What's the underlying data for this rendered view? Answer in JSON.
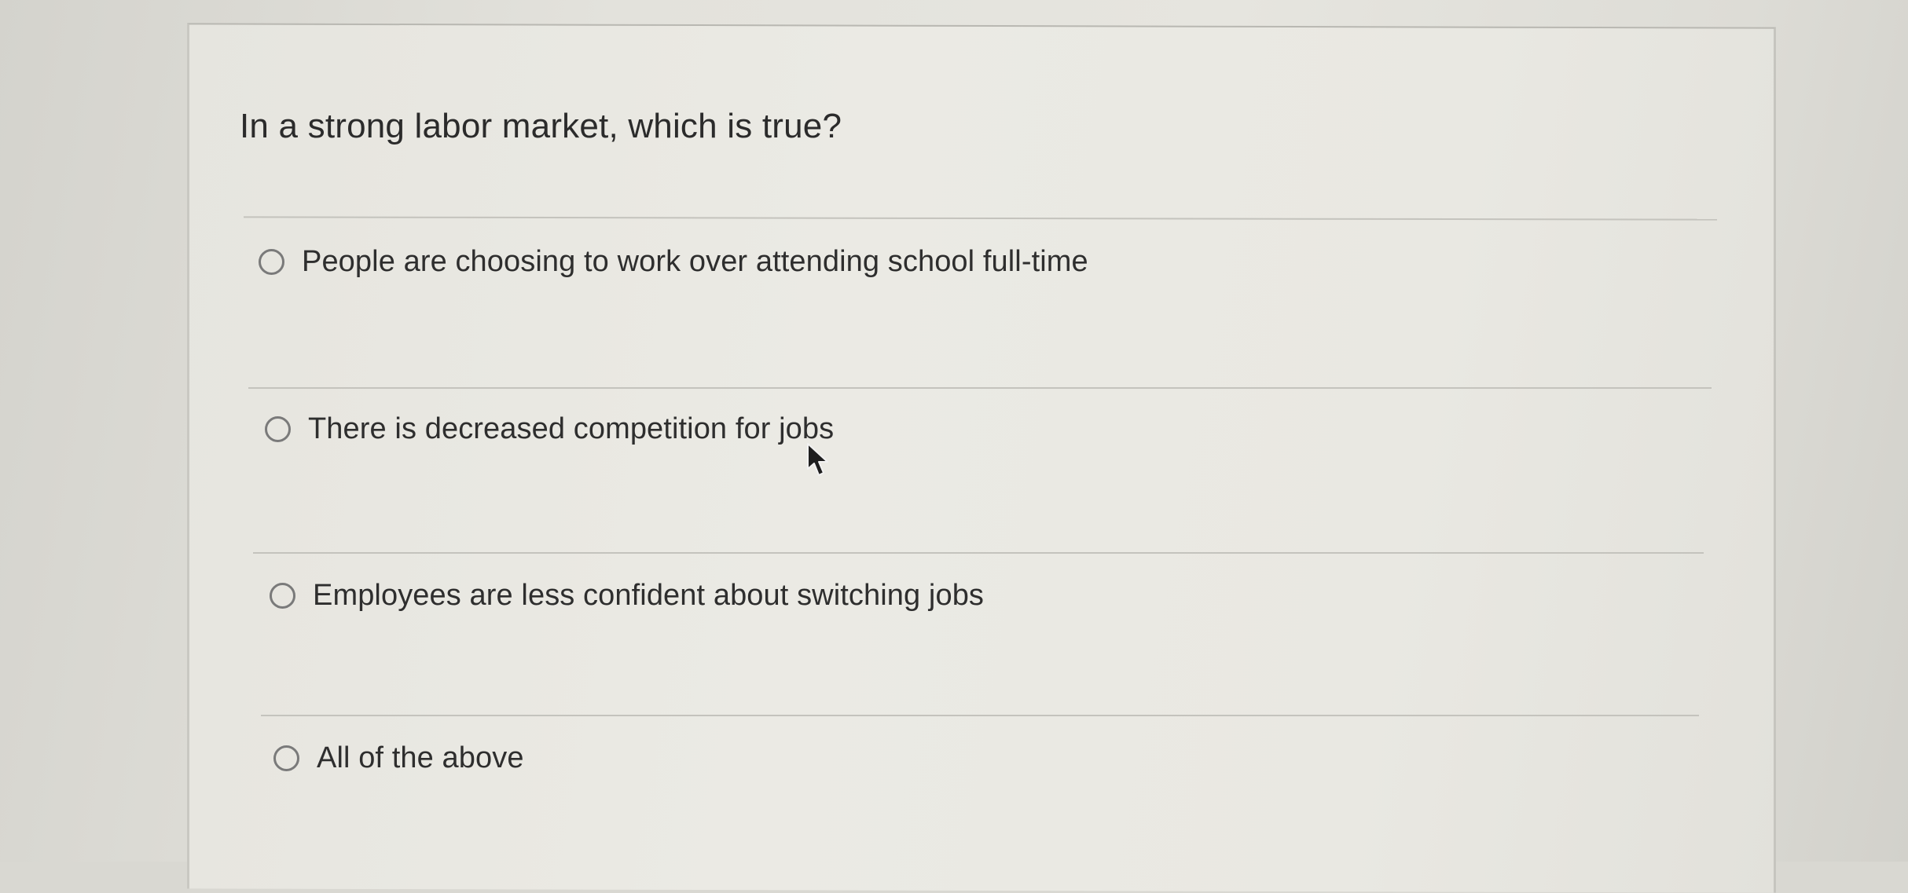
{
  "question": {
    "text": "In a strong labor market, which is true?"
  },
  "options": [
    {
      "label": "People are choosing to work over attending school full-time",
      "selected": false
    },
    {
      "label": "There is decreased competition for jobs",
      "selected": false
    },
    {
      "label": "Employees are less confident about switching jobs",
      "selected": false
    },
    {
      "label": "All of the above",
      "selected": false
    }
  ],
  "icons": {
    "cursor": "arrow-cursor-icon"
  },
  "colors": {
    "text": "#2e2e2e",
    "radio_border": "#7a7a7a",
    "background": "#e6e5df"
  }
}
